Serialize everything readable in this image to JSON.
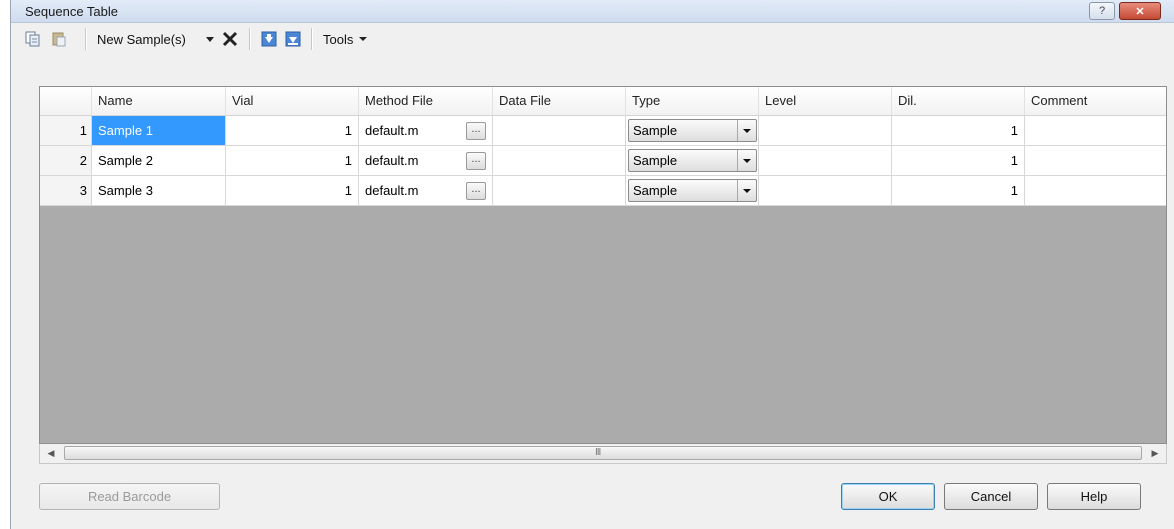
{
  "window": {
    "title": "Sequence Table",
    "help_label": "?",
    "close_label": "✕"
  },
  "toolbar": {
    "new_samples_label": "New Sample(s)",
    "tools_label": "Tools"
  },
  "table": {
    "headers": [
      "Name",
      "Vial",
      "Method File",
      "Data File",
      "Type",
      "Level",
      "Dil.",
      "Comment"
    ],
    "rows": [
      {
        "n": "1",
        "name": "Sample 1",
        "vial": "1",
        "method": "default.m",
        "ellipsis": "...",
        "data_file": "",
        "type": "Sample",
        "level": "",
        "dil": "1",
        "comment": ""
      },
      {
        "n": "2",
        "name": "Sample 2",
        "vial": "1",
        "method": "default.m",
        "ellipsis": "...",
        "data_file": "",
        "type": "Sample",
        "level": "",
        "dil": "1",
        "comment": ""
      },
      {
        "n": "3",
        "name": "Sample 3",
        "vial": "1",
        "method": "default.m",
        "ellipsis": "...",
        "data_file": "",
        "type": "Sample",
        "level": "",
        "dil": "1",
        "comment": ""
      }
    ],
    "scroll_grip": "III"
  },
  "buttons": {
    "read_barcode": "Read Barcode",
    "ok": "OK",
    "cancel": "Cancel",
    "help": "Help"
  },
  "colors": {
    "selection": "#3399ff",
    "empty_area": "#ababab"
  }
}
